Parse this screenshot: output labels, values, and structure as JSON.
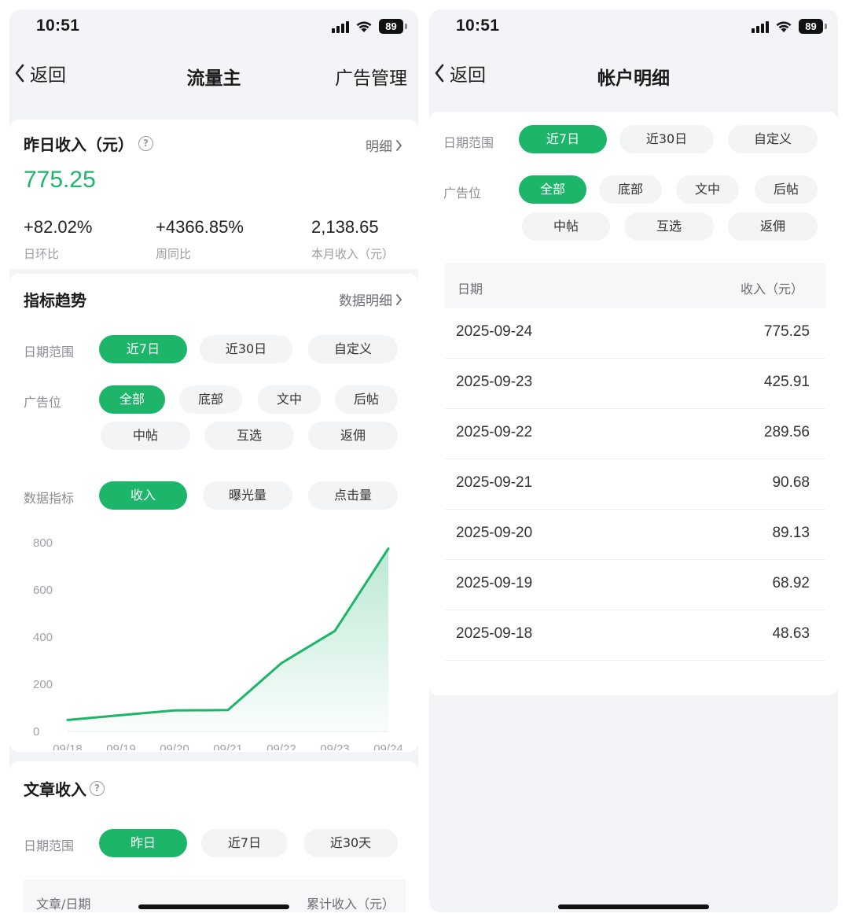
{
  "status": {
    "time": "10:51",
    "battery": "89"
  },
  "left": {
    "nav": {
      "back": "返回",
      "title": "流量主",
      "right": "广告管理"
    },
    "yesterday": {
      "title": "昨日收入（元）",
      "detail_link": "明细",
      "amount": "775.25",
      "stats": [
        {
          "value": "+82.02%",
          "label": "日环比"
        },
        {
          "value": "+4366.85%",
          "label": "周同比"
        },
        {
          "value": "2,138.65",
          "label": "本月收入（元）"
        }
      ]
    },
    "trend": {
      "title": "指标趋势",
      "detail_link": "数据明细",
      "date_label": "日期范围",
      "date_options": [
        "近7日",
        "近30日",
        "自定义"
      ],
      "ad_label": "广告位",
      "ad_options": [
        "全部",
        "底部",
        "文中",
        "后帖",
        "中帖",
        "互选",
        "返佣"
      ],
      "metric_label": "数据指标",
      "metric_options": [
        "收入",
        "曝光量",
        "点击量"
      ]
    },
    "article": {
      "title": "文章收入",
      "date_label": "日期范围",
      "date_options": [
        "昨日",
        "近7日",
        "近30天"
      ],
      "col_article": "文章/日期",
      "col_income": "累计收入（元）"
    }
  },
  "chart_data": {
    "type": "area",
    "categories": [
      "09/18",
      "09/19",
      "09/20",
      "09/21",
      "09/22",
      "09/23",
      "09/24"
    ],
    "values": [
      48.63,
      68.92,
      89.13,
      90.68,
      289.56,
      425.91,
      775.25
    ],
    "y_ticks": [
      "0",
      "200",
      "400",
      "600",
      "800"
    ],
    "ylim": [
      0,
      800
    ],
    "color": "#1cb56a",
    "grid": false,
    "legend": "none"
  },
  "right": {
    "nav": {
      "back": "返回",
      "title": "帐户明细"
    },
    "date_label": "日期范围",
    "date_options": [
      "近7日",
      "近30日",
      "自定义"
    ],
    "ad_label": "广告位",
    "ad_options": [
      "全部",
      "底部",
      "文中",
      "后帖",
      "中帖",
      "互选",
      "返佣"
    ],
    "table": {
      "col_date": "日期",
      "col_income": "收入（元）",
      "rows": [
        {
          "date": "2025-09-24",
          "income": "775.25"
        },
        {
          "date": "2025-09-23",
          "income": "425.91"
        },
        {
          "date": "2025-09-22",
          "income": "289.56"
        },
        {
          "date": "2025-09-21",
          "income": "90.68"
        },
        {
          "date": "2025-09-20",
          "income": "89.13"
        },
        {
          "date": "2025-09-19",
          "income": "68.92"
        },
        {
          "date": "2025-09-18",
          "income": "48.63"
        }
      ]
    }
  },
  "colors": {
    "accent": "#1cb56a",
    "background": "#f3f4f7"
  }
}
